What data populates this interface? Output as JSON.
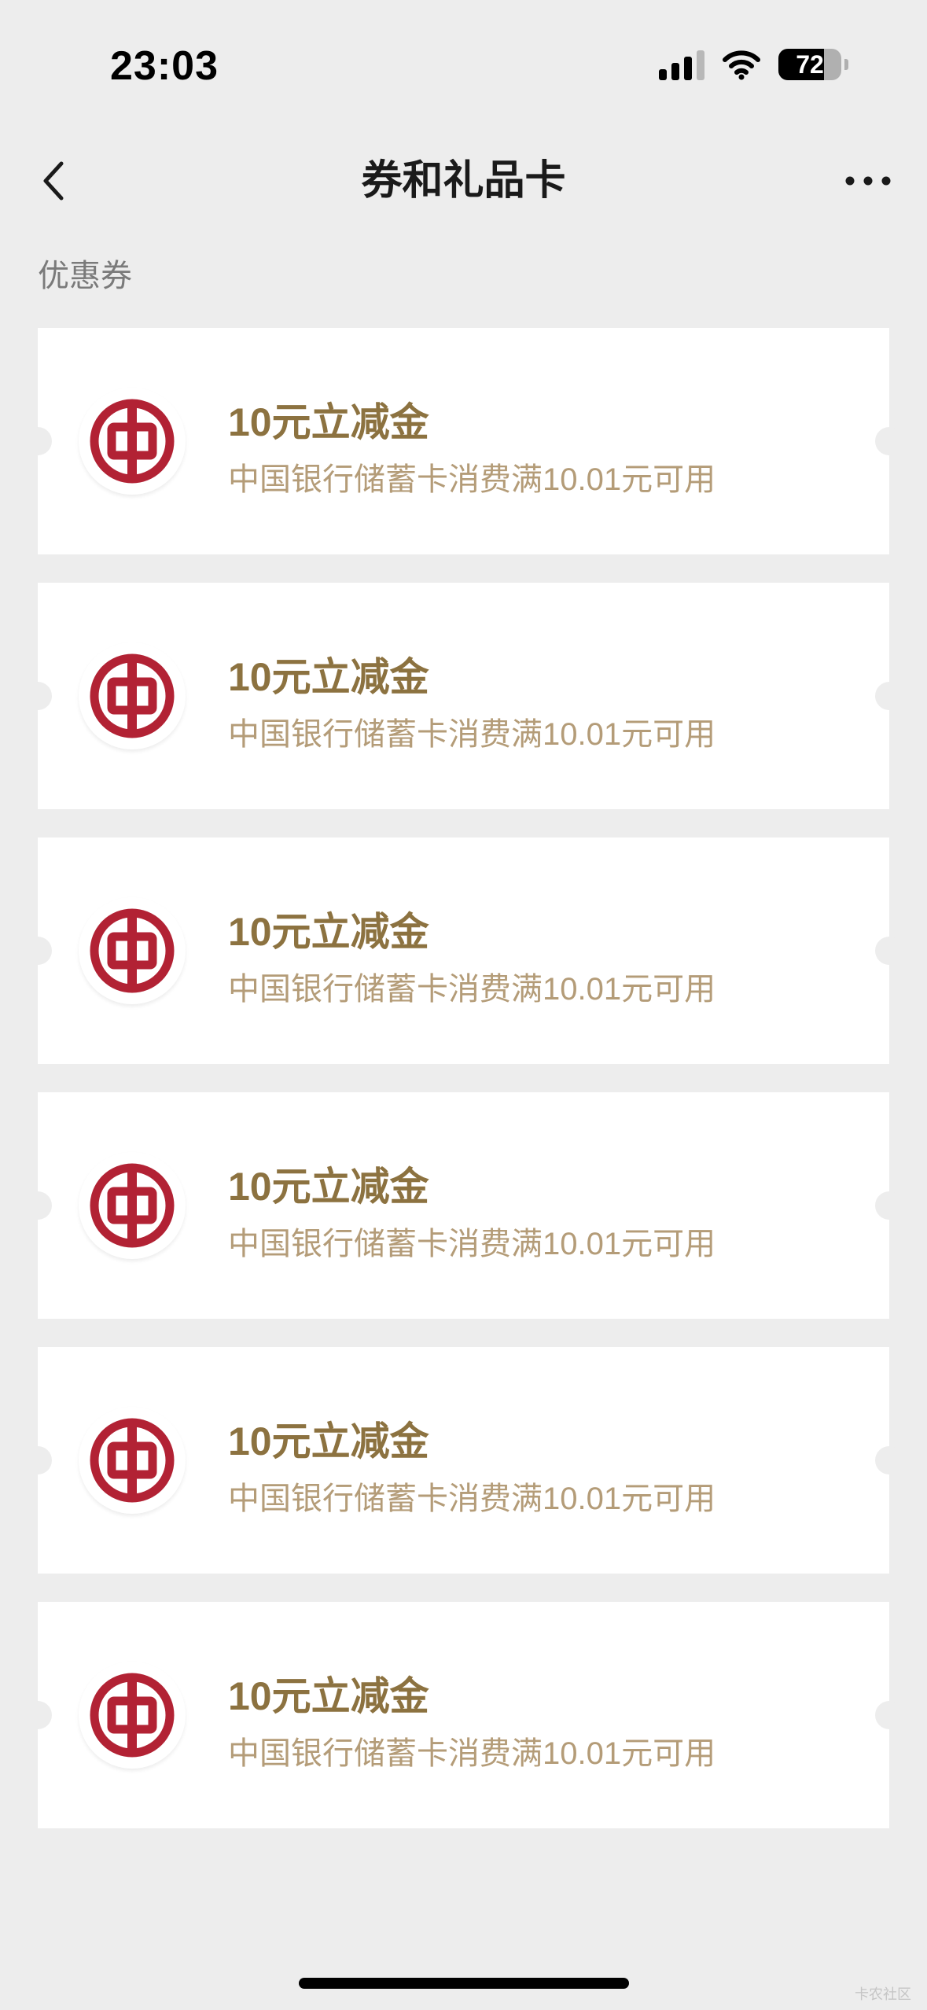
{
  "status_bar": {
    "time": "23:03",
    "battery_level": "72",
    "battery_fraction": 0.72
  },
  "nav": {
    "title": "券和礼品卡"
  },
  "section": {
    "label": "优惠券"
  },
  "coupons": [
    {
      "title": "10元立减金",
      "description": "中国银行储蓄卡消费满10.01元可用",
      "logo": "bank-of-china-logo"
    },
    {
      "title": "10元立减金",
      "description": "中国银行储蓄卡消费满10.01元可用",
      "logo": "bank-of-china-logo"
    },
    {
      "title": "10元立减金",
      "description": "中国银行储蓄卡消费满10.01元可用",
      "logo": "bank-of-china-logo"
    },
    {
      "title": "10元立减金",
      "description": "中国银行储蓄卡消费满10.01元可用",
      "logo": "bank-of-china-logo"
    },
    {
      "title": "10元立减金",
      "description": "中国银行储蓄卡消费满10.01元可用",
      "logo": "bank-of-china-logo"
    },
    {
      "title": "10元立减金",
      "description": "中国银行储蓄卡消费满10.01元可用",
      "logo": "bank-of-china-logo"
    }
  ],
  "watermark": "卡农社区",
  "colors": {
    "background": "#ededed",
    "coupon_title": "#8c7240",
    "coupon_desc": "#b49c78",
    "logo_red": "#b22234"
  }
}
